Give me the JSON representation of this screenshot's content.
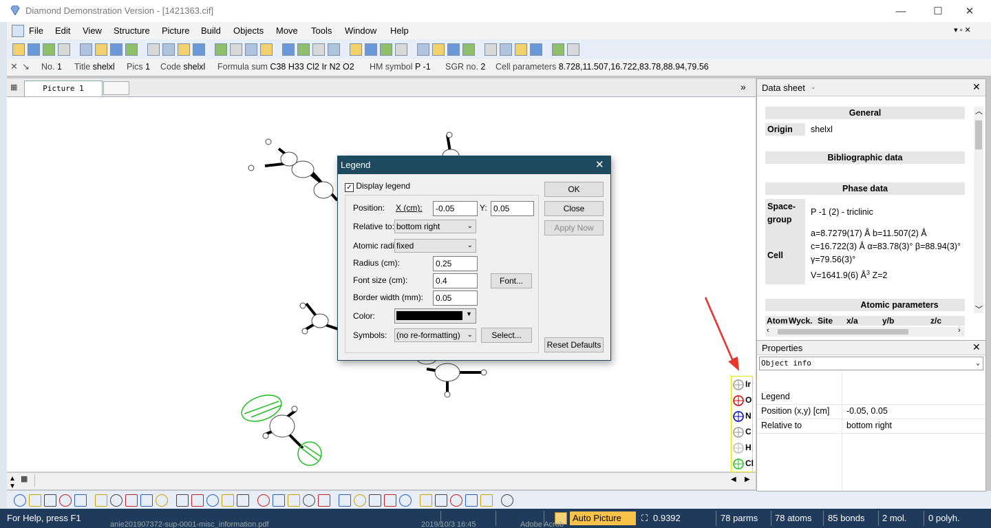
{
  "window": {
    "title": "Diamond Demonstration Version - [1421363.cif]",
    "controls": {
      "minimize": "—",
      "maximize": "☐",
      "close": "✕"
    },
    "mdi_controls": "▾ ▫ ✕"
  },
  "menu": [
    "File",
    "Edit",
    "View",
    "Structure",
    "Picture",
    "Build",
    "Objects",
    "Move",
    "Tools",
    "Window",
    "Help"
  ],
  "infobar": {
    "no_label": "No.",
    "no": "1",
    "title_label": "Title",
    "title": "shelxl",
    "pics_label": "Pics",
    "pics": "1",
    "code_label": "Code",
    "code": "shelxl",
    "formula_label": "Formula sum",
    "formula": "C38 H33 Cl2 Ir N2 O2",
    "hm_label": "HM symbol",
    "hm": "P -1",
    "sgr_label": "SGR no.",
    "sgr": "2",
    "cell_label": "Cell parameters",
    "cell": "8.728,11.507,16.722,83.78,88.94,79.56"
  },
  "tabs": {
    "picture": "Picture 1",
    "more": "»"
  },
  "datasheet": {
    "header": "Data sheet",
    "general": "General",
    "origin_label": "Origin",
    "origin": "shelxl",
    "bibliographic": "Bibliographic data",
    "phase": "Phase data",
    "spacegroup_label_1": "Space-",
    "spacegroup_label_2": "group",
    "spacegroup": "P -1 (2) - triclinic",
    "cell_label": "Cell",
    "cell_line1": "a=8.7279(17) Å b=11.507(2) Å",
    "cell_line2": "c=16.722(3) Å α=83.78(3)° β=88.94(3)°",
    "cell_line3": "γ=79.56(3)°",
    "cell_line4": "V=1641.9(6) Å",
    "cell_line4_sup": "3",
    "cell_line4_z": " Z=2",
    "atomic": "Atomic parameters",
    "cols": [
      "Atom",
      "Wyck.",
      "Site",
      "x/a",
      "y/b",
      "z/c"
    ]
  },
  "properties": {
    "header": "Properties",
    "combo": "Object info",
    "rows": [
      {
        "k": "Legend",
        "v": ""
      },
      {
        "k": "Position (x,y) [cm]",
        "v": "-0.05, 0.05"
      },
      {
        "k": "Relative to",
        "v": "bottom right"
      }
    ]
  },
  "dialog": {
    "title": "Legend",
    "display_legend": "Display legend",
    "position": "Position:",
    "x_label": "X (cm):",
    "x_value": "-0.05",
    "y_label": "Y:",
    "y_value": "0.05",
    "relative_label": "Relative to:",
    "relative_value": "bottom right",
    "radii_label": "Atomic radii:",
    "radii_value": "fixed",
    "radius_label": "Radius (cm):",
    "radius_value": "0.25",
    "fontsize_label": "Font size (cm):",
    "fontsize_value": "0.4",
    "border_label": "Border width (mm):",
    "border_value": "0.05",
    "color_label": "Color:",
    "color_value": "#000000",
    "symbols_label": "Symbols:",
    "symbols_value": "(no re-formatting)",
    "ok": "OK",
    "close": "Close",
    "apply": "Apply Now",
    "font_btn": "Font...",
    "select_btn": "Select...",
    "reset": "Reset Defaults"
  },
  "legend_items": [
    {
      "label": "Ir",
      "color": "#9a9a9a"
    },
    {
      "label": "O",
      "color": "#d40000"
    },
    {
      "label": "N",
      "color": "#0000c8"
    },
    {
      "label": "C",
      "color": "#9a9a9a"
    },
    {
      "label": "H",
      "color": "#bbbbbb"
    },
    {
      "label": "Cl",
      "color": "#1fbf1f"
    }
  ],
  "statusbar": {
    "help": "For Help, press F1",
    "mode": "Auto Picture",
    "zoom": "0.9392",
    "parms": "78 parms",
    "atoms": "78 atoms",
    "bonds": "85 bonds",
    "mol": "2 mol.",
    "polyh": "0 polyh."
  },
  "behind_text": {
    "file": "anie201907372-sup-0001-misc_information.pdf",
    "date": "2019/10/3 16:45",
    "app": "Adobe Acrob"
  },
  "colors": {
    "accent": "#1d4a5e",
    "status": "#1f3a5a",
    "annotation_arrow": "#e8362d",
    "legend_border": "#e6e600"
  }
}
